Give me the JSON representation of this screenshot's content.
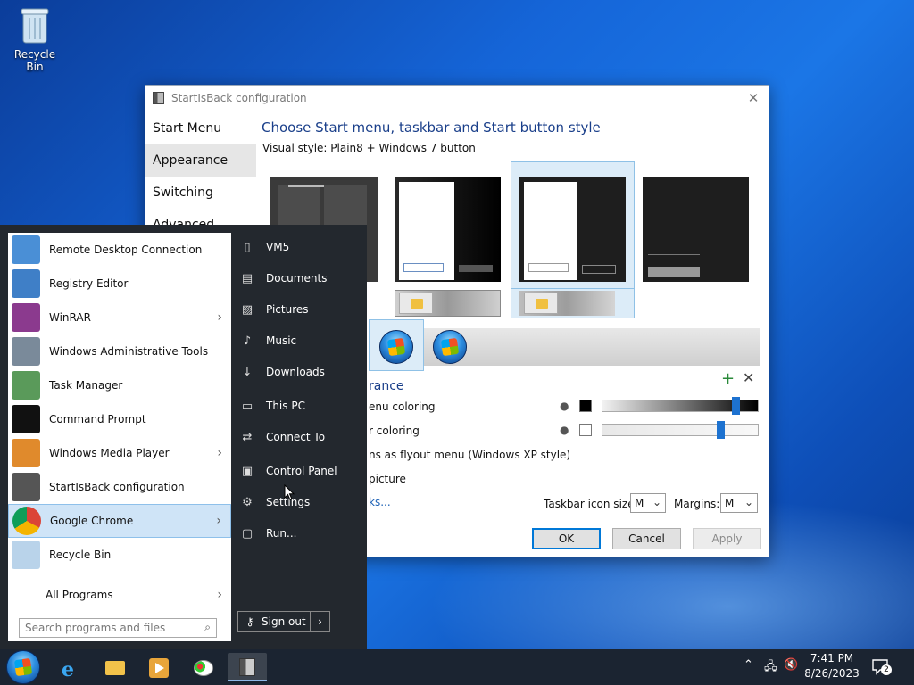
{
  "desktop": {
    "recycle_bin_label": "Recycle Bin"
  },
  "config_window": {
    "title": "StartIsBack configuration",
    "nav": [
      "Start Menu",
      "Appearance",
      "Switching",
      "Advanced"
    ],
    "heading": "Choose Start menu, taskbar and Start button style",
    "visual_style": "Visual style:  Plain8 + Windows 7 button",
    "appearance_heading": "rance",
    "options": {
      "menu_coloring": "enu coloring",
      "taskbar_coloring": "r coloring",
      "flyout": "ns as flyout menu (Windows XP style)",
      "picture": "picture",
      "link": "ks..."
    },
    "taskbar_icon_size_label": "Taskbar icon size:",
    "taskbar_icon_size_value": "M",
    "margins_label": "Margins:",
    "margins_value": "M",
    "buttons": {
      "ok": "OK",
      "cancel": "Cancel",
      "apply": "Apply"
    },
    "slider_menu_fraction": 0.85,
    "slider_taskbar_fraction": 0.75
  },
  "start_menu": {
    "programs": [
      {
        "label": "Remote Desktop Connection",
        "icon": "remote-desktop-icon",
        "arrow": false
      },
      {
        "label": "Registry Editor",
        "icon": "registry-editor-icon",
        "arrow": false
      },
      {
        "label": "WinRAR",
        "icon": "winrar-icon",
        "arrow": true
      },
      {
        "label": "Windows Administrative Tools",
        "icon": "admin-tools-icon",
        "arrow": false
      },
      {
        "label": "Task Manager",
        "icon": "task-manager-icon",
        "arrow": false
      },
      {
        "label": "Command Prompt",
        "icon": "command-prompt-icon",
        "arrow": false
      },
      {
        "label": "Windows Media Player",
        "icon": "media-player-icon",
        "arrow": true
      },
      {
        "label": "StartIsBack configuration",
        "icon": "startisback-icon",
        "arrow": false
      },
      {
        "label": "Google Chrome",
        "icon": "chrome-icon",
        "arrow": true
      },
      {
        "label": "Recycle Bin",
        "icon": "recycle-bin-icon",
        "arrow": false
      }
    ],
    "all_programs": "All Programs",
    "search_placeholder": "Search programs and files",
    "places": [
      {
        "label": "VM5",
        "icon": "user-folder-icon"
      },
      {
        "label": "Documents",
        "icon": "documents-icon"
      },
      {
        "label": "Pictures",
        "icon": "pictures-icon"
      },
      {
        "label": "Music",
        "icon": "music-icon"
      },
      {
        "label": "Downloads",
        "icon": "downloads-icon"
      },
      {
        "label": "This PC",
        "icon": "this-pc-icon"
      },
      {
        "label": "Connect To",
        "icon": "connect-to-icon"
      },
      {
        "label": "Control Panel",
        "icon": "control-panel-icon"
      },
      {
        "label": "Settings",
        "icon": "gear-icon"
      },
      {
        "label": "Run...",
        "icon": "run-icon"
      }
    ],
    "sign_out": "Sign out"
  },
  "taskbar": {
    "time": "7:41 PM",
    "date": "8/26/2023",
    "notification_count": "2"
  }
}
